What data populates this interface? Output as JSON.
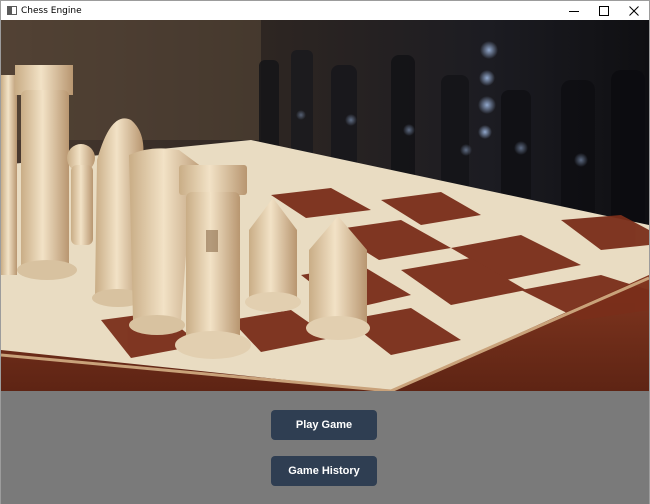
{
  "window": {
    "title": "Chess Engine",
    "app_icon": "window-app-icon",
    "controls": {
      "minimize_icon": "minimize-icon",
      "maximize_icon": "maximize-icon",
      "close_icon": "close-icon"
    }
  },
  "hero": {
    "image": "wooden-chess-pieces-on-board"
  },
  "menu": {
    "play_label": "Play Game",
    "history_label": "Game History"
  },
  "colors": {
    "button_bg": "#2f3e52",
    "panel_bg": "#7a7a7a",
    "button_text": "#ffffff"
  }
}
